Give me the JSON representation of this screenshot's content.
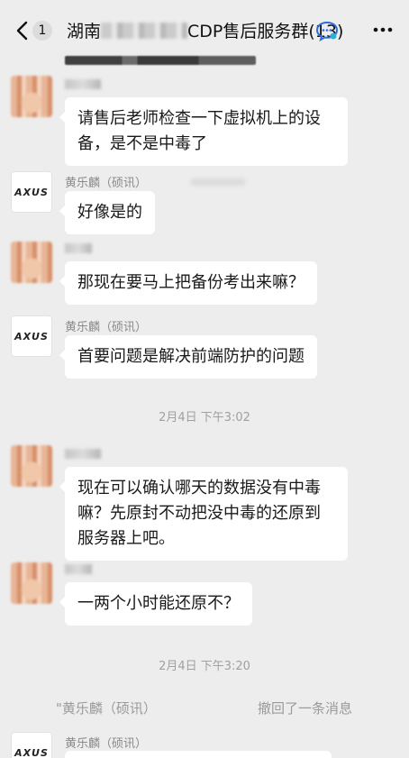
{
  "header": {
    "back_count": "1",
    "title_prefix": "湖南",
    "title_suffix": "CDP售后服务群(13)",
    "icons": {
      "back": "chevron-left-icon",
      "chat": "chat-bubble-icon",
      "more": "more-dots-icon"
    }
  },
  "messages": [
    {
      "sender": "",
      "avatar": "photo",
      "text_line1": "请售后老师检查一下虚拟机上的设",
      "text_line2": "备，是不是中毒了"
    },
    {
      "sender": "黄乐麟（硕讯）",
      "avatar": "logo",
      "avatar_text": "AXUS",
      "text": "好像是的"
    },
    {
      "sender": "",
      "avatar": "photo",
      "text": "那现在要马上把备份考出来嘛？"
    },
    {
      "sender": "黄乐麟（硕讯）",
      "avatar": "logo",
      "avatar_text": "AXUS",
      "text": "首要问题是解决前端防护的问题"
    },
    {
      "sender": "",
      "avatar": "photo",
      "text_line1": "现在可以确认哪天的数据没有中毒",
      "text_line2": "嘛？先原封不动把没中毒的还原到",
      "text_line3": "服务器上吧。"
    },
    {
      "sender": "",
      "avatar": "photo",
      "text": "一两个小时能还原不？"
    },
    {
      "sender": "黄乐麟（硕讯）",
      "avatar": "logo",
      "avatar_text": "AXUS"
    }
  ],
  "timestamps": {
    "t1": "2月4日 下午3:02",
    "t2": "2月4日 下午3:20"
  },
  "recall": {
    "name": "\"黄乐麟（硕讯）",
    "text": "撤回了一条消息"
  },
  "colors": {
    "background": "#ededed",
    "bubble": "#ffffff",
    "meta_text": "#a0a0a0"
  }
}
